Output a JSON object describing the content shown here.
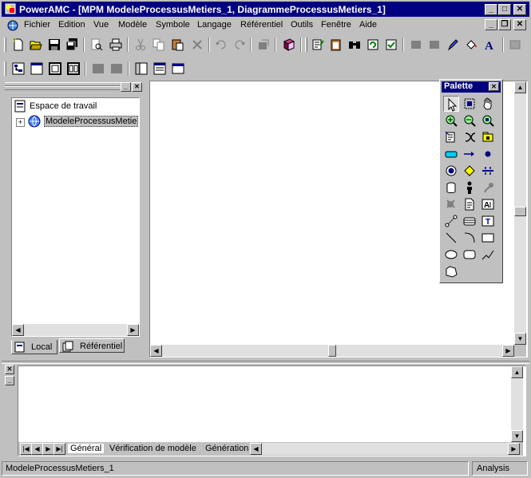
{
  "window": {
    "title": "PowerAMC - [MPM ModeleProcessusMetiers_1, DiagrammeProcessusMetiers_1]"
  },
  "menu": {
    "items": [
      "Fichier",
      "Edition",
      "Vue",
      "Modèle",
      "Symbole",
      "Langage",
      "Référentiel",
      "Outils",
      "Fenêtre",
      "Aide"
    ]
  },
  "browser": {
    "root_label": "Espace de travail",
    "model_label": "ModeleProcessusMetiers_1",
    "tabs": [
      "Local",
      "Référentiel"
    ]
  },
  "palette": {
    "title": "Palette",
    "tools": [
      "pointer-icon",
      "lasso-icon",
      "grabber-icon",
      "zoom-in-icon",
      "zoom-out-icon",
      "zoom-fit-icon",
      "properties-icon",
      "delete-icon",
      "package-icon",
      "process-icon",
      "flow-icon",
      "start-icon",
      "end-icon",
      "decision-icon",
      "synchronization-icon",
      "resource-icon",
      "organization-unit-icon",
      "message-format-icon",
      "data-icon",
      "document-icon",
      "text-icon",
      "link-icon",
      "table-icon",
      "title-icon",
      "line-icon",
      "arc-icon",
      "rectangle-icon",
      "ellipse-icon",
      "rounded-rectangle-icon",
      "polyline-icon",
      "polygon-icon"
    ]
  },
  "output": {
    "tabs": [
      "Général",
      "Vérification de modèle",
      "Génération"
    ]
  },
  "status": {
    "left": "ModeleProcessusMetiers_1",
    "right": "Analysis"
  },
  "colors": {
    "titlebar": "#000080",
    "face": "#c0c0c0"
  }
}
